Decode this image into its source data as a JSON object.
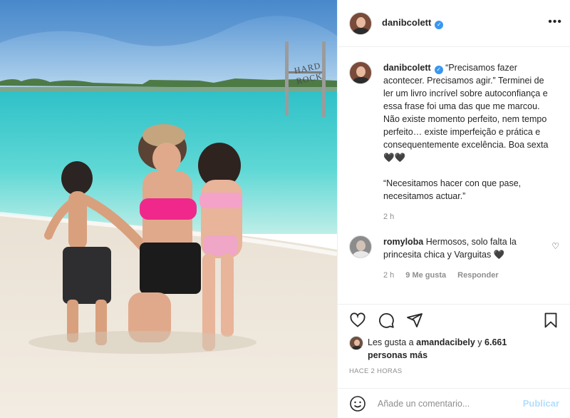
{
  "post": {
    "username": "danibcolett",
    "verified": true,
    "sign_text": "HARD ROCK"
  },
  "caption": {
    "username": "danibcolett",
    "text": "“Precisamos fazer acontecer. Precisamos agir.” Terminei de ler um livro incrível sobre autoconfiança e essa frase foi uma das que me marcou. Não existe momento perfeito, nem tempo perfeito… existe imperfeição e prática e consequentemente excelência. Boa sexta 🖤🖤\n\n“Necesitamos hacer con que pase, necesitamos actuar.”",
    "time": "2 h"
  },
  "comments": [
    {
      "username": "romyloba",
      "text": "Hermosos, solo falta la princesita chica y Varguitas 🖤",
      "time": "2 h",
      "likes": "9 Me gusta",
      "reply": "Responder"
    }
  ],
  "likes": {
    "prefix": "Les gusta a",
    "user": "amandacibely",
    "conj": "y",
    "count": "6.661 personas más"
  },
  "time_ago": "HACE 2 HORAS",
  "add_comment": {
    "placeholder": "Añade un comentario...",
    "publish": "Publicar"
  },
  "icons": [
    "more-icon",
    "heart-icon",
    "comment-icon",
    "share-icon",
    "bookmark-icon",
    "emoji-icon",
    "verified-icon"
  ],
  "colors": {
    "verified": "#3897f0",
    "publish_disabled": "#b2dffc",
    "secondary_text": "#8e8e8e",
    "border": "#efefef"
  }
}
